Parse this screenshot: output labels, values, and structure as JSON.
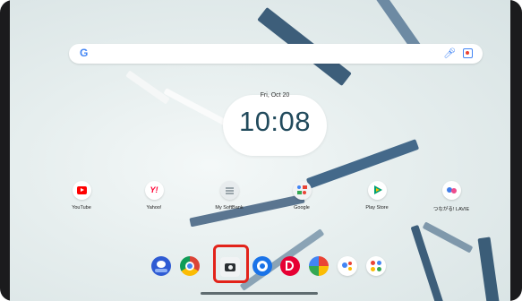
{
  "search": {
    "google_letter": "G"
  },
  "clock": {
    "date": "Fri, Oct 20",
    "time": "10:08"
  },
  "apps": [
    {
      "label": "YouTube"
    },
    {
      "label": "Yahoo!",
      "glyph": "Y!"
    },
    {
      "label": "My SoftBank"
    },
    {
      "label": "Google"
    },
    {
      "label": "Play Store"
    },
    {
      "label": "つながる! LAVIE"
    }
  ],
  "dock": [
    {
      "name": "messages-icon",
      "color": "#2f5bd3"
    },
    {
      "name": "chrome-icon",
      "color": "#db4437"
    },
    {
      "name": "camera-icon",
      "color": "#2b2f33"
    },
    {
      "name": "settings-icon",
      "color": "#1a73e8"
    },
    {
      "name": "d-point-icon",
      "color": "#e60033"
    },
    {
      "name": "photos-icon",
      "color": "#fbbc04"
    },
    {
      "name": "assistant-icon",
      "color": "#4285f4"
    },
    {
      "name": "apps-icon",
      "color": "#ea4335"
    }
  ],
  "highlight_color": "#e2231a"
}
